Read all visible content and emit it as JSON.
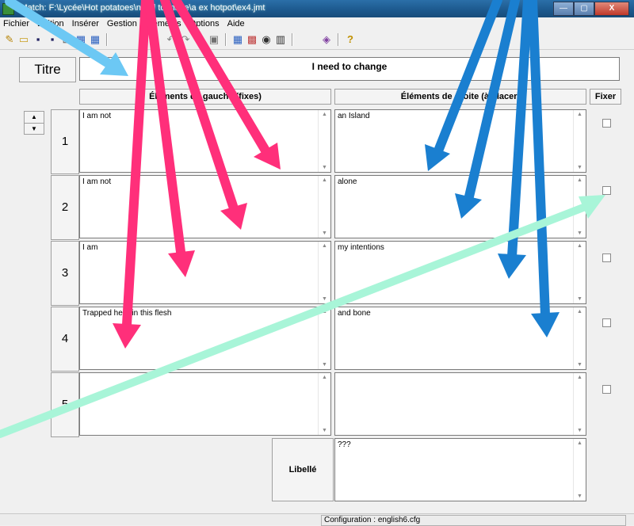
{
  "window": {
    "title": "JMatch: F:\\Lycée\\Hot potatoes\\need to make\\a ex hotpot\\ex4.jmt",
    "controls": [
      "—",
      "▢",
      "X"
    ]
  },
  "menu": [
    "Fichier",
    "Edition",
    "Insérer",
    "Gestion",
    "Éléments",
    "Options",
    "Aide"
  ],
  "toolbar": {
    "icons": [
      "new-icon",
      "open-icon",
      "save-icon",
      "save-as-icon",
      "export-icon",
      "web-icon",
      "web2-icon",
      "undo-icon",
      "redo-icon",
      "copy-icon",
      "paste-icon",
      "web3-icon",
      "screen-icon",
      "globe-icon",
      "grid-icon",
      "lock-icon",
      "help-icon"
    ]
  },
  "title_row": {
    "label": "Titre",
    "value": "I need to change"
  },
  "columns": {
    "left": "Éléments de gauche (fixes)",
    "right": "Éléments de droite (à placer)",
    "fix": "Fixer"
  },
  "rows": [
    {
      "num": "1",
      "left": "I am not",
      "right": "an Island"
    },
    {
      "num": "2",
      "left": "I am not",
      "right": "alone"
    },
    {
      "num": "3",
      "left": "I am",
      "right": "my intentions"
    },
    {
      "num": "4",
      "left": "Trapped here in this flesh",
      "right": "and bone"
    },
    {
      "num": "5",
      "left": "",
      "right": ""
    }
  ],
  "libelle": {
    "label": "Libellé",
    "value": "???"
  },
  "status": {
    "config": "Configuration : english6.cfg"
  },
  "colors": {
    "pink_arrow": "#ff2f7a",
    "blue_arrow": "#1a7fd0",
    "cyan_arrow": "#6cc8f4",
    "mint_arrow": "#a8f5d8"
  }
}
